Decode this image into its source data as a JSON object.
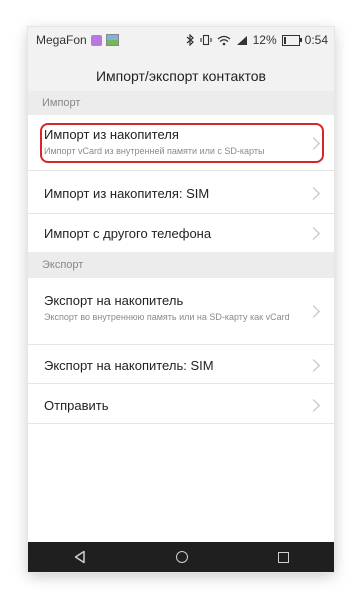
{
  "status_bar": {
    "carrier": "MegaFon",
    "battery_percent_text": "12%",
    "battery_level": 0.12,
    "time": "0:54",
    "icons": [
      "app-icon",
      "gallery-icon",
      "bluetooth-icon",
      "vibrate-icon",
      "wifi-icon",
      "signal-icon",
      "battery-icon"
    ]
  },
  "header": {
    "title": "Импорт/экспорт контактов"
  },
  "sections": {
    "import": {
      "label": "Импорт",
      "items": [
        {
          "title": "Импорт из накопителя",
          "subtitle": "Импорт vCard из внутренней памяти или с SD-карты"
        },
        {
          "title": "Импорт из накопителя: SIM"
        },
        {
          "title": "Импорт с другого телефона"
        }
      ]
    },
    "export": {
      "label": "Экспорт",
      "items": [
        {
          "title": "Экспорт на накопитель",
          "subtitle": "Экспорт во внутреннюю память или на SD-карту как vCard"
        },
        {
          "title": "Экспорт на накопитель: SIM"
        },
        {
          "title": "Отправить"
        }
      ]
    }
  },
  "navigation": {
    "icons": [
      "back-icon",
      "home-icon",
      "recent-apps-icon"
    ]
  },
  "colors": {
    "highlight": "#d7262b",
    "header_bg": "#f2f2f2",
    "section_bg": "#ececec",
    "navbar_bg": "#1f1f1f"
  }
}
